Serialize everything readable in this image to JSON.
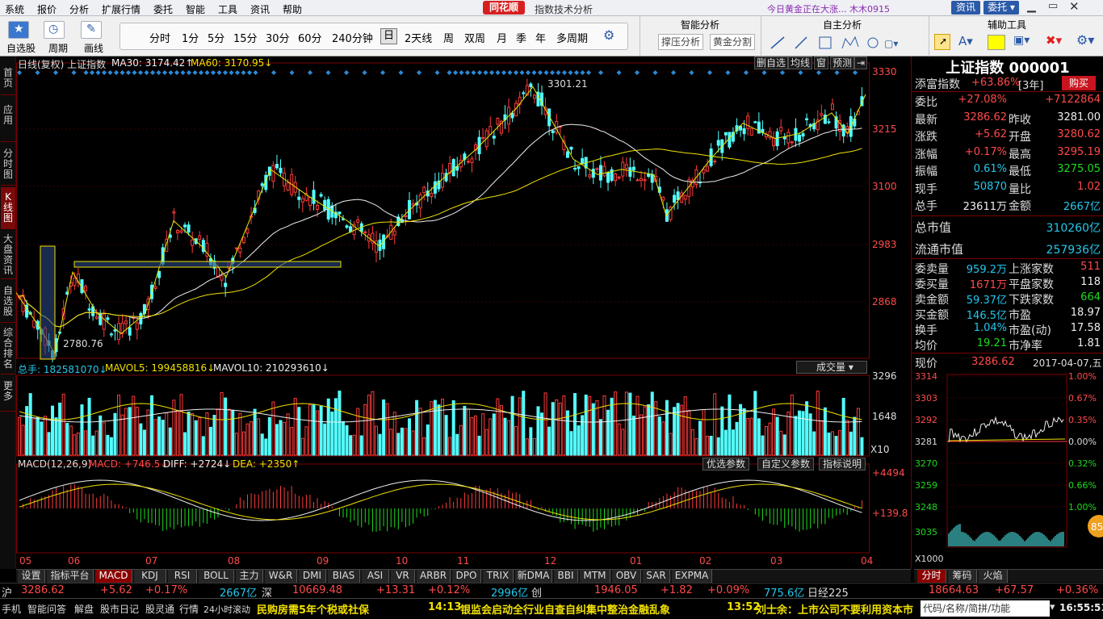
{
  "menu": {
    "items": [
      "系统",
      "报价",
      "分析",
      "扩展行情",
      "委托",
      "智能",
      "工具",
      "资讯",
      "帮助"
    ],
    "logo": "同花顺",
    "title": "指数技术分析",
    "news": "今日黄金正在大涨... 木木0915",
    "btn1": "资讯",
    "btn2": "委托 ▾"
  },
  "toolbar": {
    "tools": [
      "自选股",
      "周期",
      "画线"
    ],
    "periods": [
      "分时",
      "1分",
      "5分",
      "15分",
      "30分",
      "60分",
      "240分钟",
      "日",
      "2天线",
      "周",
      "双周",
      "月",
      "季",
      "年",
      "多周期"
    ],
    "selected_period": "日",
    "smart": {
      "title": "智能分析",
      "btn1": "撑压分析",
      "btn2": "黄金分割"
    },
    "self": {
      "title": "自主分析"
    },
    "aux": {
      "title": "辅助工具"
    }
  },
  "nav": [
    "首页",
    "应用",
    "分时图",
    "K线图",
    "大盘资讯",
    "自选股",
    "综合排名",
    "更多"
  ],
  "nav_active": 3,
  "main": {
    "head_left": "日线(复权)  上证指数",
    "ma30": "MA30: 3174.42↑",
    "ma60": "MA60: 3170.95↓",
    "tags": [
      "删自选",
      "均线",
      "窗",
      "预测",
      "⇥"
    ],
    "price_ticks": [
      "3330",
      "3215",
      "3100",
      "2983",
      "2868"
    ],
    "high_label": "3301.21",
    "low_label": "2780.76",
    "vol_label": "总手: 182581070↓",
    "mavol5": "MAVOL5: 199458816↓",
    "mavol10": "MAVOL10: 210293610↓",
    "vol_tag": "成交量 ▾",
    "vol_ticks": [
      "3296",
      "1648",
      "X10"
    ],
    "macd_label": "MACD(12,26,9)",
    "macd_val": "MACD: +746.5↓",
    "diff": "DIFF: +2724↓",
    "dea": "DEA: +2350↑",
    "macd_tags": [
      "优选参数",
      "自定义参数",
      "指标说明"
    ],
    "macd_ticks": [
      "+4494",
      "+139.8"
    ],
    "months": [
      "05",
      "06",
      "07",
      "08",
      "09",
      "10",
      "11",
      "12",
      "01",
      "02",
      "03",
      "04"
    ]
  },
  "quote": {
    "name": "上证指数 000001",
    "tfzs": "添富指数",
    "tfzs_val": "+63.86%",
    "tfzs_y": "[3年]",
    "buy": "购买",
    "rows": [
      [
        "委比",
        "+27.08%",
        "",
        "+7122864"
      ],
      [
        "最新",
        "3286.62",
        "昨收",
        "3281.00"
      ],
      [
        "涨跌",
        "+5.62",
        "开盘",
        "3280.62"
      ],
      [
        "涨幅",
        "+0.17%",
        "最高",
        "3295.19"
      ],
      [
        "振幅",
        "0.61%",
        "最低",
        "3275.05"
      ],
      [
        "现手",
        "50870",
        "量比",
        "1.02"
      ],
      [
        "总手",
        "23611万",
        "金额",
        "2667亿"
      ]
    ],
    "total_mv": "总市值",
    "total_mv_v": "310260亿",
    "float_mv": "流通市值",
    "float_mv_v": "257936亿",
    "rows2": [
      [
        "委卖量",
        "959.2万",
        "上涨家数",
        "511"
      ],
      [
        "委买量",
        "1671万",
        "平盘家数",
        "118"
      ],
      [
        "卖金额",
        "59.37亿",
        "下跌家数",
        "664"
      ],
      [
        "买金额",
        "146.5亿",
        "市盈",
        "18.97"
      ],
      [
        "换手",
        "1.04%",
        "市盈(动)",
        "17.58"
      ],
      [
        "均价",
        "19.21",
        "市净率",
        "1.81"
      ]
    ],
    "now_lbl": "现价",
    "now_val": "3286.62",
    "date": "2017-04-07,五",
    "mini_ticks": [
      "3314",
      "3303",
      "3292",
      "3281",
      "3270",
      "3259",
      "3248",
      "3035"
    ],
    "mini_pct": [
      "1.00%",
      "0.67%",
      "0.35%",
      "0.00%",
      "0.32%",
      "0.66%",
      "1.00%"
    ],
    "mini_x": "X1000",
    "tabs": [
      "分时",
      "筹码",
      "火焰"
    ],
    "bubble": "85"
  },
  "btabs": [
    "设置",
    "指标平台",
    "MACD",
    "KDJ",
    "RSI",
    "BOLL",
    "主力",
    "W&R",
    "DMI",
    "BIAS",
    "ASI",
    "VR",
    "ARBR",
    "DPO",
    "TRIX",
    "新DMA",
    "BBI",
    "MTM",
    "OBV",
    "SAR",
    "EXPMA"
  ],
  "btab_sel": "MACD",
  "status1": {
    "sh": "沪",
    "p1": "3286.62",
    "c1": "+5.62",
    "r1": "+0.17%",
    "a1": "2667亿",
    "sz": "深",
    "p2": "10669.48",
    "c2": "+13.31",
    "r2": "+0.12%",
    "a2": "2996亿",
    "cy": "创",
    "p3": "1946.05",
    "c3": "+1.82",
    "r3": "+0.09%",
    "a3": "775.6亿",
    "rz": "日经225",
    "p4": "18664.63",
    "c4": "+67.57",
    "r4": "+0.36%"
  },
  "status2": {
    "items": [
      "手机",
      "智能问答",
      "解盘",
      "股市日记",
      "股灵通",
      "行情",
      "24小时滚动"
    ],
    "news1": "民购房需5年个税或社保",
    "t2": "14:13",
    "news2": "银监会启动全行业自查自纠集中整治金融乱象",
    "t3": "13:52",
    "news3": "刘士余：上市公司不要利用资本市",
    "search": "代码/名称/简拼/功能",
    "clock": "16:55:51"
  },
  "chart_data": {
    "type": "candlestick",
    "title": "上证指数 日线",
    "ylim": [
      2780,
      3330
    ],
    "high": 3301.21,
    "low": 2780.76,
    "ma30_last": 3174.42,
    "ma60_last": 3170.95,
    "months": [
      "05",
      "06",
      "07",
      "08",
      "09",
      "10",
      "11",
      "12",
      "01",
      "02",
      "03",
      "04"
    ],
    "macd": {
      "macd": 746.5,
      "diff": 2724,
      "dea": 2350
    }
  },
  "colors": {
    "up": "#ff3b3b",
    "down": "#54ffff",
    "ma": "#f0f000",
    "brand": "#d62020"
  }
}
